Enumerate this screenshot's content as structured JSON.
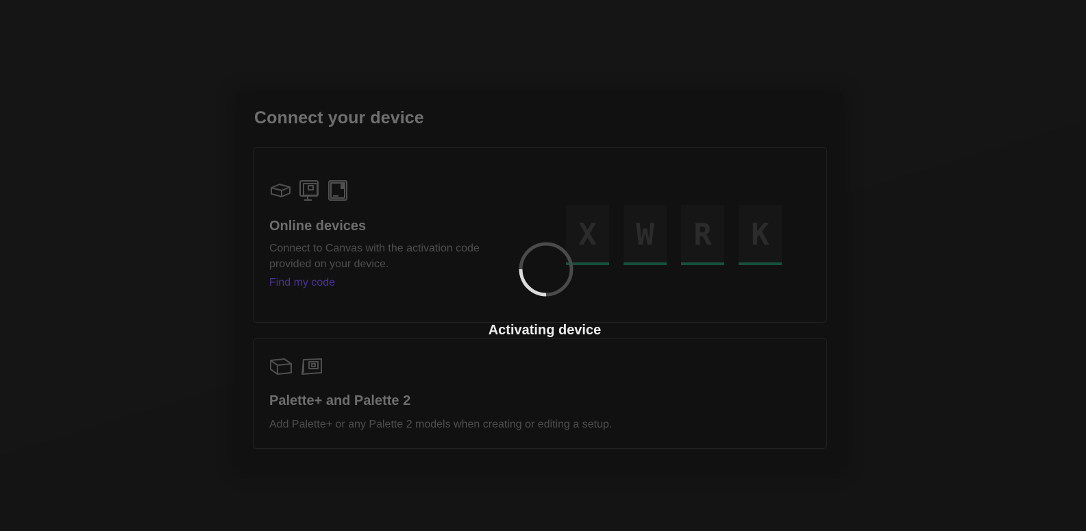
{
  "page": {
    "title": "Connect your device"
  },
  "online_card": {
    "icons": [
      "device-slab-icon",
      "desktop-device-icon",
      "tablet-device-icon"
    ],
    "heading": "Online devices",
    "description": "Connect to Canvas with the activation code provided on your device.",
    "link_label": "Find my code",
    "activation_code": [
      "X",
      "W",
      "R",
      "K"
    ]
  },
  "palette_card": {
    "icons": [
      "palette-plus-icon",
      "palette-2-icon"
    ],
    "heading": "Palette+ and Palette 2",
    "description": "Add Palette+ or any Palette 2 models when creating or editing a setup."
  },
  "overlay": {
    "status": "Activating device",
    "spinner_icon": "loading-spinner-icon"
  },
  "colors": {
    "background": "#141414",
    "panel": "#111111",
    "link": "#4a3397",
    "code_underline": "#17513d",
    "status_text": "#ececec"
  }
}
